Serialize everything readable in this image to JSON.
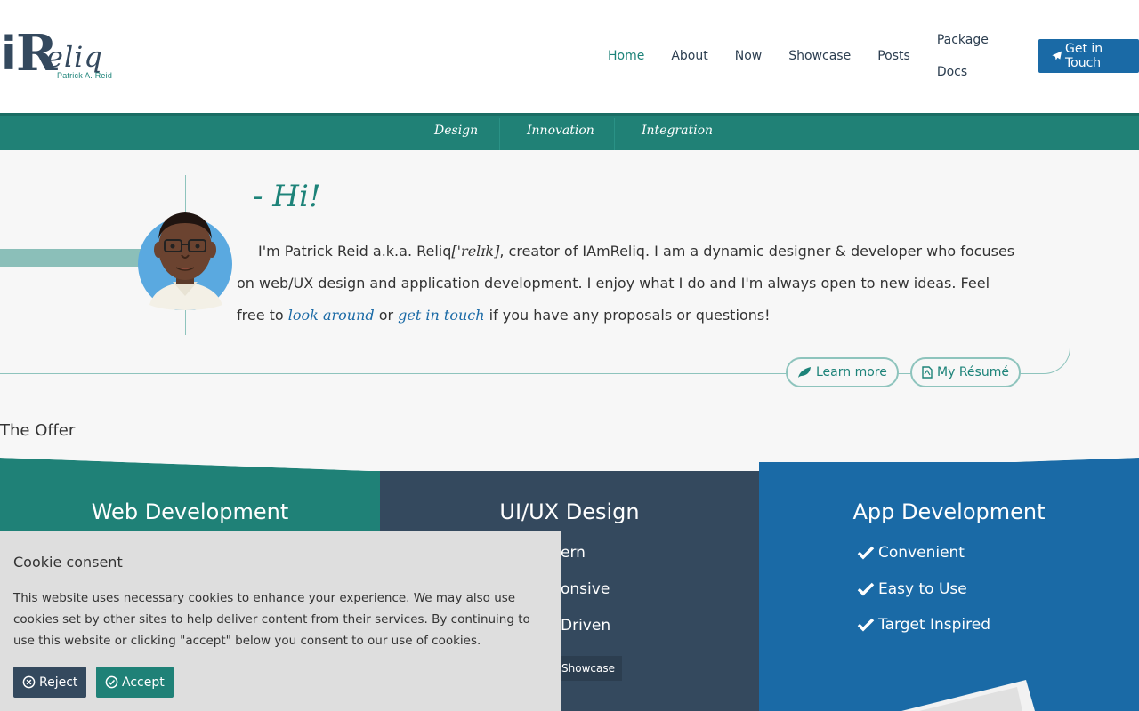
{
  "header": {
    "logo": {
      "letter_i": "i",
      "letter_r": "R",
      "word": "eliq",
      "tagline": "Patrick A. Reid"
    },
    "nav": [
      {
        "label": "Home",
        "active": true
      },
      {
        "label": "About"
      },
      {
        "label": "Now"
      },
      {
        "label": "Showcase"
      },
      {
        "label": "Posts"
      },
      {
        "label": "Package Docs"
      }
    ],
    "cta_label": "Get in Touch"
  },
  "subnav": [
    "Design",
    "Innovation",
    "Integration"
  ],
  "hero": {
    "greeting": "- Hi!",
    "intro_pre": "I'm Patrick Reid a.k.a. Reliq",
    "phonetic": "['relɪk]",
    "intro_mid": ", creator of IAmReliq. I am a dynamic designer & developer who focuses on web/UX design and application development. I enjoy what I do and I'm always open to new ideas. Feel free to ",
    "link_look": "look around",
    "or_text": " or ",
    "link_touch": "get in touch",
    "intro_post": " if you have any proposals or questions!",
    "learn_more": "Learn more",
    "resume": "My Résumé"
  },
  "offer": {
    "title": "The Offer",
    "panels": [
      {
        "title": "Web Development",
        "color": "#1f8177"
      },
      {
        "title": "UI/UX Design",
        "color": "#34495e",
        "features": [
          "ern",
          "onsive",
          "Driven"
        ],
        "button": "Showcase"
      },
      {
        "title": "App Development",
        "color": "#1a6aa6",
        "features": [
          "Convenient",
          "Easy to Use",
          "Target Inspired"
        ]
      }
    ]
  },
  "cookie": {
    "title": "Cookie consent",
    "text": "This website uses necessary cookies to enhance your experience. We may also use cookies set by other sites to help deliver content from their services. By continuing to use this website or clicking \"accept\" below you consent to our use of cookies.",
    "reject": "Reject",
    "accept": "Accept"
  },
  "colors": {
    "teal": "#1d8379",
    "blue": "#1a6aa6",
    "navy": "#34495e"
  }
}
